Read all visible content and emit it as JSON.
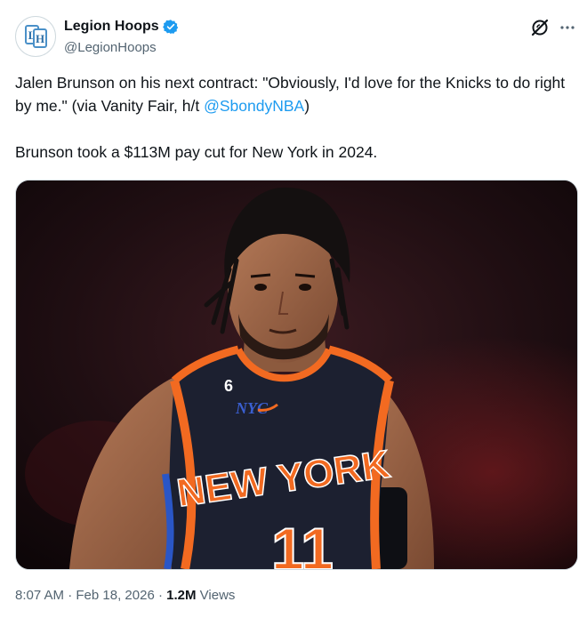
{
  "author": {
    "display_name": "Legion Hoops",
    "handle": "@LegionHoops",
    "verified": true,
    "avatar_icon": "legion-hoops-logo"
  },
  "header_actions": {
    "grok_icon": "grok-icon",
    "more_icon": "more-options-icon"
  },
  "tweet": {
    "line1_before": "Jalen Brunson on his next contract: \"Obviously, I'd love for the Knicks to do right by me.\" (via Vanity Fair, h/t ",
    "mention": "@SbondyNBA",
    "line1_after": ")",
    "line2": "Brunson took a $113M pay cut for New York in 2024."
  },
  "media": {
    "jersey_wordmark": "NEW YORK",
    "jersey_number": "11",
    "shoulder_number": "6",
    "jersey_patch": "NYC"
  },
  "meta": {
    "time": "8:07 AM",
    "separator": "·",
    "date": "Feb 18, 2026",
    "views_count": "1.2M",
    "views_label": "Views"
  },
  "colors": {
    "link": "#1d9bf0",
    "secondary_text": "#536471",
    "verified_badge": "#1d9bf0",
    "jersey_orange": "#f26a21",
    "jersey_navy": "#1c2030"
  }
}
